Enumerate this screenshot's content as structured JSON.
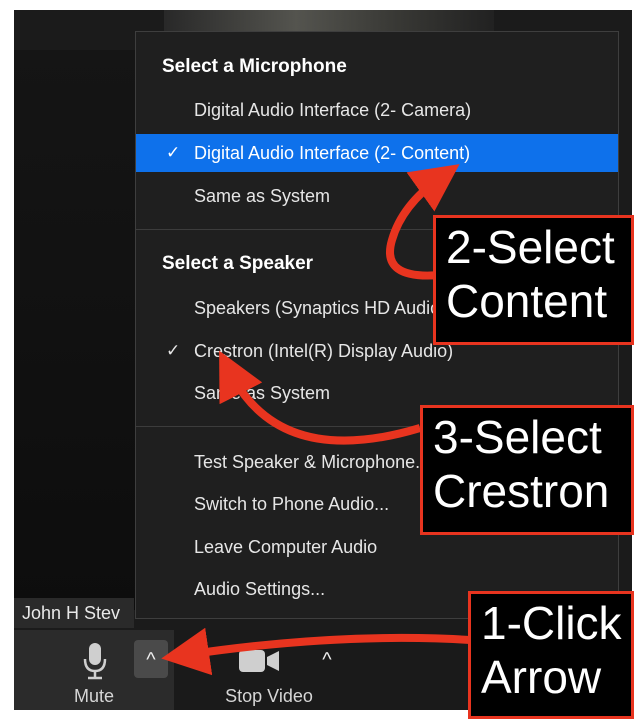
{
  "participant": {
    "name": "John H Stev"
  },
  "toolbar": {
    "mute_label": "Mute",
    "video_label": "Stop Video",
    "mic_arrow": "^",
    "video_arrow": "^"
  },
  "menu": {
    "mic_heading": "Select a Microphone",
    "mic_items": [
      "Digital Audio Interface (2- Camera)",
      "Digital Audio Interface (2- Content)",
      "Same as System"
    ],
    "speaker_heading": "Select a Speaker",
    "speaker_items": [
      "Speakers (Synaptics HD Audio)",
      "Crestron (Intel(R) Display Audio)",
      "Same as System"
    ],
    "action_items": [
      "Test Speaker & Microphone...",
      "Switch to Phone Audio...",
      "Leave Computer Audio",
      "Audio Settings..."
    ],
    "checkmark": "✓"
  },
  "annotations": {
    "step1": "1-Click\nArrow",
    "step2": "2-Select\nContent",
    "step3": "3-Select\nCrestron"
  },
  "colors": {
    "highlight": "#0e71eb",
    "annotation_red": "#e8341f"
  }
}
